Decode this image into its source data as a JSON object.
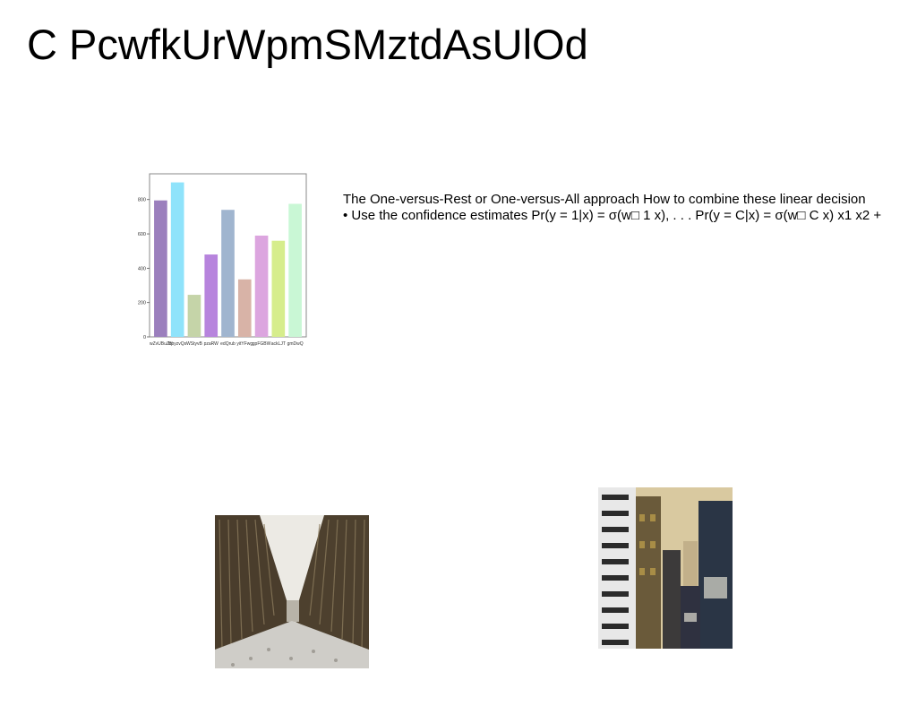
{
  "slide": {
    "title": "C PcwfkUrWpmSMztdAsUlOd",
    "text_line1": "The One-versus-Rest or One-versus-All approach How to combine these linear decision",
    "text_line2": "• Use the confidence estimates Pr(y = 1|x) = σ(w□ 1 x), . . . Pr(y = C|x) = σ(w□ C x) x1 x2 +"
  },
  "chart_data": {
    "type": "bar",
    "categories": [
      "wZvUBuZq",
      "BbyzvQs",
      "WStyvB",
      "pzaRW",
      "edQrub",
      "yitYFwg",
      "gpFGBW",
      "ackLJT",
      "gmDwQ"
    ],
    "values": [
      795,
      900,
      245,
      480,
      740,
      335,
      590,
      560,
      775
    ],
    "colors": [
      "#9b7fbd",
      "#8fe3fb",
      "#c5d4a8",
      "#b784dd",
      "#a0b5cf",
      "#d8b3a7",
      "#dca5df",
      "#d6ed8c",
      "#c9f7d5"
    ],
    "yticks": [
      0,
      200,
      400,
      600,
      800
    ],
    "ylim": [
      0,
      950
    ]
  },
  "images": {
    "street_photo": "photo of a snowy pedestrian street between tall slatted buildings",
    "city_photo": "photo of city skyscrapers in sepia tones"
  }
}
